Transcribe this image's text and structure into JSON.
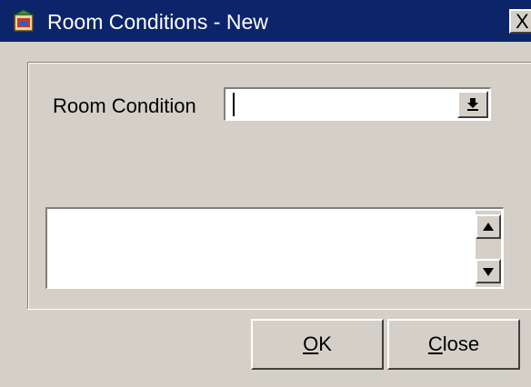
{
  "window": {
    "title": "Room Conditions - New",
    "close_glyph": "X",
    "icon": "app-icon"
  },
  "form": {
    "room_condition_label": "Room Condition",
    "room_condition_value": "",
    "dropdown_icon": "down-arrow-icon",
    "notes_value": ""
  },
  "buttons": {
    "ok": {
      "mnemonic": "O",
      "rest": "K"
    },
    "close": {
      "mnemonic": "C",
      "rest": "lose"
    }
  },
  "colors": {
    "titlebar": "#0c246a",
    "dialog_face": "#d4d0c8",
    "field_bg": "#ffffff"
  }
}
